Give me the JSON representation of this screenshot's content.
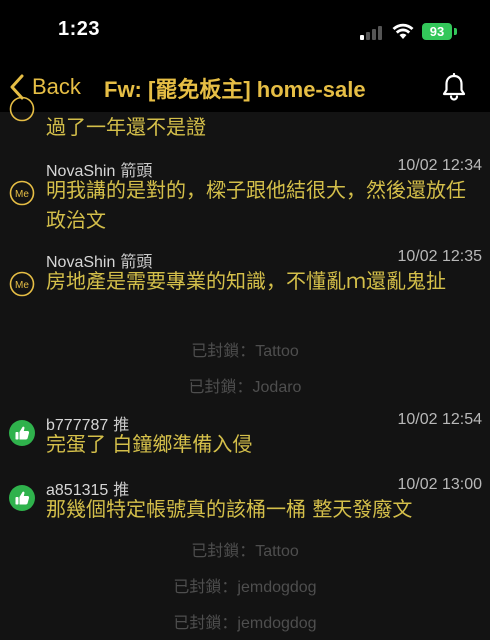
{
  "status_bar": {
    "time": "1:23",
    "battery": "93"
  },
  "nav": {
    "back_label": "Back",
    "title": "Fw: [罷免板主] home-sale"
  },
  "partial_text": "過了一年還不是證",
  "comments": [
    {
      "user": "NovaShin",
      "tag": "箭頭",
      "time": "10/02 12:34",
      "icon": "me-badge-icon",
      "text": "明我講的是對的，樑子跟他結很大，然後還放任政治文"
    },
    {
      "user": "NovaShin",
      "tag": "箭頭",
      "time": "10/02 12:35",
      "icon": "me-badge-icon",
      "text": "房地產是需要專業的知識，不懂亂ｍ還亂鬼扯"
    },
    {
      "user": "b777787",
      "tag": "推",
      "time": "10/02 12:54",
      "icon": "thumbs-up-icon",
      "text": "完蛋了 白鐘鄉準備入侵"
    },
    {
      "user": "a851315",
      "tag": "推",
      "time": "10/02 13:00",
      "icon": "thumbs-up-icon",
      "text": "那幾個特定帳號真的該桶一桶 整天發廢文"
    }
  ],
  "blocked": [
    "已封鎖：Tattoo",
    "已封鎖：Jodaro",
    "已封鎖：Tattoo",
    "已封鎖：jemdogdog",
    "已封鎖：jemdogdog"
  ],
  "colors": {
    "background": "#131313",
    "accent": "#e6be45",
    "comment_text": "#d4bf4a",
    "upvote_green": "#2fb24c",
    "battery_green": "#33c75a"
  }
}
